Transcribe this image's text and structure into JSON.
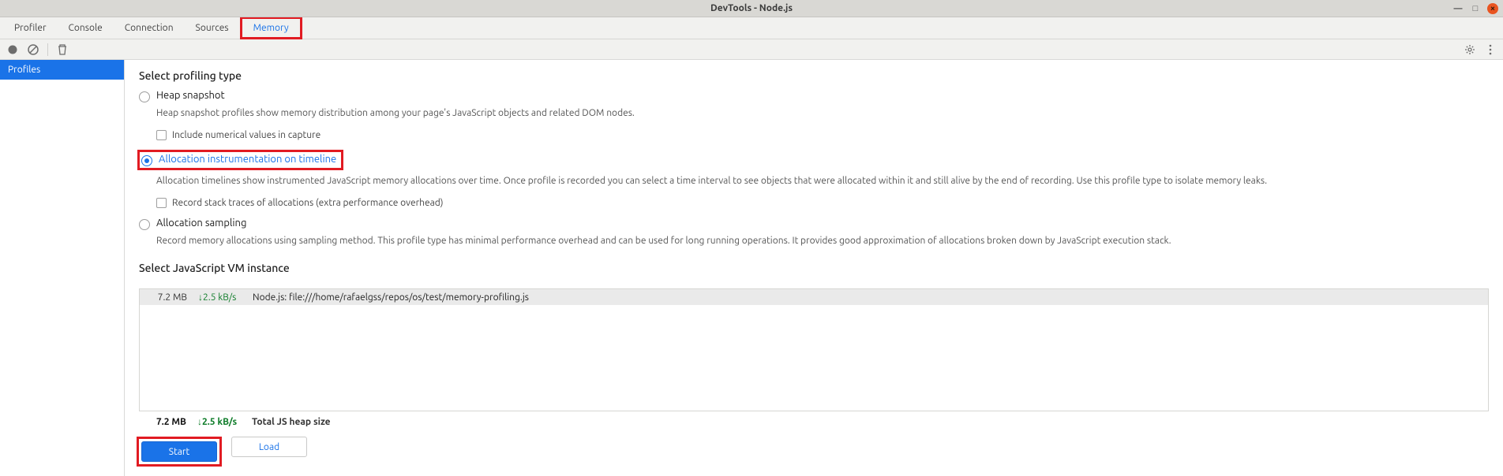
{
  "window": {
    "title": "DevTools - Node.js"
  },
  "tabs": {
    "items": [
      "Profiler",
      "Console",
      "Connection",
      "Sources",
      "Memory"
    ],
    "active": 4
  },
  "sidebar": {
    "items": [
      {
        "label": "Profiles"
      }
    ]
  },
  "section_type_title": "Select profiling type",
  "options": {
    "heap": {
      "label": "Heap snapshot",
      "desc": "Heap snapshot profiles show memory distribution among your page's JavaScript objects and related DOM nodes.",
      "check_label": "Include numerical values in capture"
    },
    "alloc_timeline": {
      "label": "Allocation instrumentation on timeline",
      "desc": "Allocation timelines show instrumented JavaScript memory allocations over time. Once profile is recorded you can select a time interval to see objects that were allocated within it and still alive by the end of recording. Use this profile type to isolate memory leaks.",
      "check_label": "Record stack traces of allocations (extra performance overhead)"
    },
    "alloc_sampling": {
      "label": "Allocation sampling",
      "desc": "Record memory allocations using sampling method. This profile type has minimal performance overhead and can be used for long running operations. It provides good approximation of allocations broken down by JavaScript execution stack."
    }
  },
  "vm": {
    "title": "Select JavaScript VM instance",
    "rows": [
      {
        "mem": "7.2 MB",
        "rate": "↓2.5 kB/s",
        "name": "Node.js: file:///home/rafaelgss/repos/os/test/memory-profiling.js"
      }
    ],
    "summary": {
      "mem": "7.2 MB",
      "rate": "↓2.5 kB/s",
      "label": "Total JS heap size"
    }
  },
  "buttons": {
    "start": "Start",
    "load": "Load"
  }
}
